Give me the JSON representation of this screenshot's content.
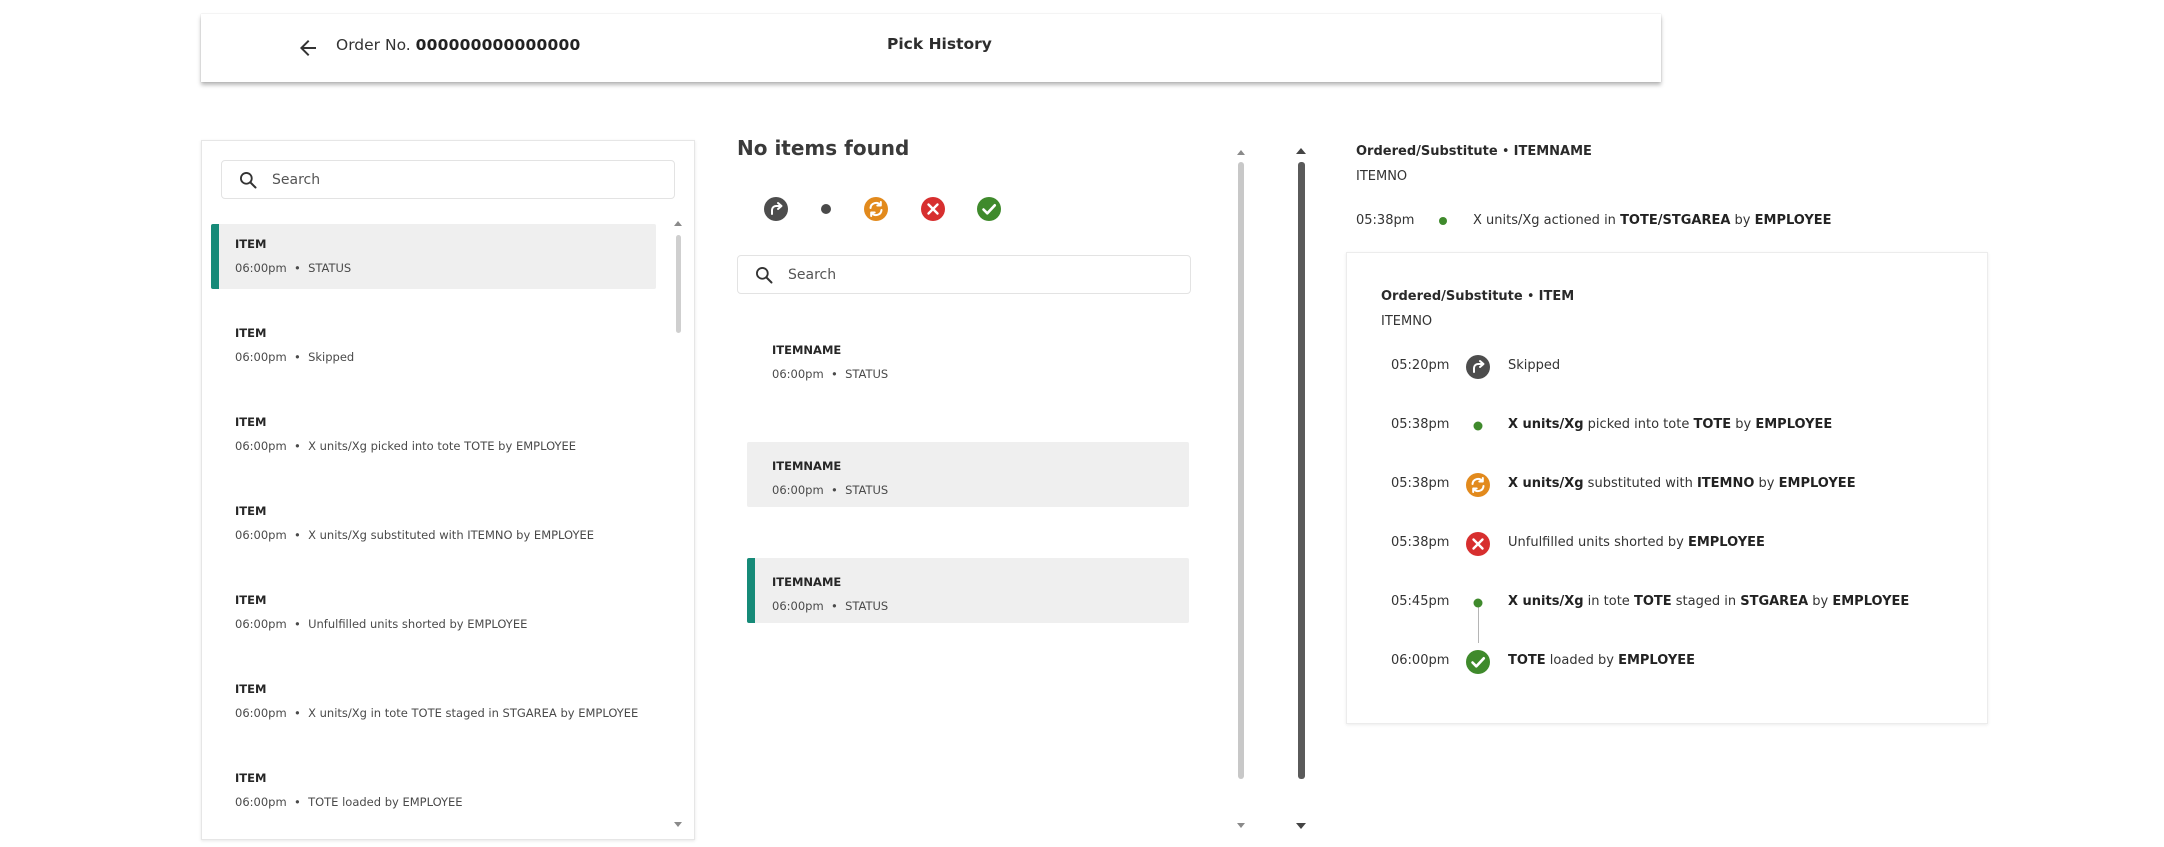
{
  "header": {
    "order_prefix": "Order No.",
    "order_number": "000000000000000",
    "page_title": "Pick History"
  },
  "left": {
    "search_placeholder": "Search",
    "items": [
      {
        "name": "ITEM",
        "time": "06:00pm",
        "detail": "STATUS",
        "selected": true
      },
      {
        "name": "ITEM",
        "time": "06:00pm",
        "detail": "Skipped"
      },
      {
        "name": "ITEM",
        "time": "06:00pm",
        "detail": "X units/Xg picked into tote TOTE by EMPLOYEE"
      },
      {
        "name": "ITEM",
        "time": "06:00pm",
        "detail": "X units/Xg substituted with ITEMNO by EMPLOYEE"
      },
      {
        "name": "ITEM",
        "time": "06:00pm",
        "detail": "Unfulfilled units shorted by EMPLOYEE"
      },
      {
        "name": "ITEM",
        "time": "06:00pm",
        "detail": "X units/Xg in tote TOTE staged in STGAREA by EMPLOYEE"
      },
      {
        "name": "ITEM",
        "time": "06:00pm",
        "detail": "TOTE loaded by EMPLOYEE"
      }
    ]
  },
  "middle": {
    "heading": "No items found",
    "filters": [
      "skipped-filter-icon",
      "picked-filter-icon",
      "substituted-filter-icon",
      "shorted-filter-icon",
      "loaded-filter-icon"
    ],
    "search_placeholder": "Search",
    "items": [
      {
        "name": "ITEMNAME",
        "time": "06:00pm",
        "detail": "STATUS",
        "style": "plain"
      },
      {
        "name": "ITEMNAME",
        "time": "06:00pm",
        "detail": "STATUS",
        "style": "shaded"
      },
      {
        "name": "ITEMNAME",
        "time": "06:00pm",
        "detail": "STATUS",
        "style": "accent"
      }
    ]
  },
  "detail": {
    "title_prefix": "Ordered/Substitute",
    "title_item": "ITEMNAME",
    "itemno": "ITEMNO",
    "summary_time": "05:38pm",
    "summary_parts": [
      {
        "t": "X units/Xg actioned in ",
        "b": false
      },
      {
        "t": "TOTE/STGAREA",
        "b": true
      },
      {
        "t": " by ",
        "b": false
      },
      {
        "t": "EMPLOYEE",
        "b": true
      }
    ],
    "card": {
      "title_prefix": "Ordered/Substitute",
      "title_item": "ITEM",
      "itemno": "ITEMNO",
      "events": [
        {
          "time": "05:20pm",
          "icon": "skipped-icon",
          "parts": [
            {
              "t": "Skipped",
              "b": false
            }
          ]
        },
        {
          "time": "05:38pm",
          "icon": "picked-dot-icon",
          "parts": [
            {
              "t": "X units/Xg",
              "b": true
            },
            {
              "t": " picked into tote ",
              "b": false
            },
            {
              "t": "TOTE",
              "b": true
            },
            {
              "t": " by ",
              "b": false
            },
            {
              "t": "EMPLOYEE",
              "b": true
            }
          ]
        },
        {
          "time": "05:38pm",
          "icon": "substituted-icon",
          "parts": [
            {
              "t": "X units/Xg",
              "b": true
            },
            {
              "t": " substituted with ",
              "b": false
            },
            {
              "t": "ITEMNO",
              "b": true
            },
            {
              "t": " by ",
              "b": false
            },
            {
              "t": "EMPLOYEE",
              "b": true
            }
          ]
        },
        {
          "time": "05:38pm",
          "icon": "shorted-icon",
          "parts": [
            {
              "t": "Unfulfilled units shorted by ",
              "b": false
            },
            {
              "t": "EMPLOYEE",
              "b": true
            }
          ]
        },
        {
          "time": "05:45pm",
          "icon": "staged-dot-icon",
          "parts": [
            {
              "t": "X units/Xg",
              "b": true
            },
            {
              "t": " in tote ",
              "b": false
            },
            {
              "t": "TOTE",
              "b": true
            },
            {
              "t": " staged in ",
              "b": false
            },
            {
              "t": "STGAREA",
              "b": true
            },
            {
              "t": " by ",
              "b": false
            },
            {
              "t": "EMPLOYEE",
              "b": true
            }
          ]
        },
        {
          "time": "06:00pm",
          "icon": "loaded-icon",
          "parts": [
            {
              "t": "TOTE",
              "b": true
            },
            {
              "t": " loaded by ",
              "b": false
            },
            {
              "t": "EMPLOYEE",
              "b": true
            }
          ]
        }
      ]
    }
  },
  "colors": {
    "accent_teal": "#168a78",
    "skipped_gray": "#4d4d4d",
    "picked_green": "#3f8a2c",
    "substituted_orange": "#e28a1d",
    "shorted_red": "#d72f2f",
    "loaded_green": "#3f8a2c"
  }
}
